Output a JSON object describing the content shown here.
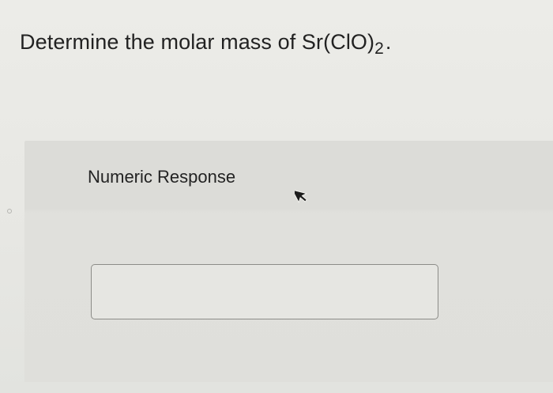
{
  "question": {
    "text_before": "Determine the molar mass of Sr(ClO)",
    "subscript": "2",
    "text_after": "."
  },
  "response": {
    "label": "Numeric Response",
    "input_value": "",
    "input_placeholder": ""
  },
  "icons": {
    "cursor": "mouse-pointer-icon",
    "dot": "dot-icon"
  },
  "colors": {
    "background": "#e9e9e5",
    "panel": "#dcdcd8",
    "input_border": "#8c8c88",
    "text": "#222222"
  }
}
